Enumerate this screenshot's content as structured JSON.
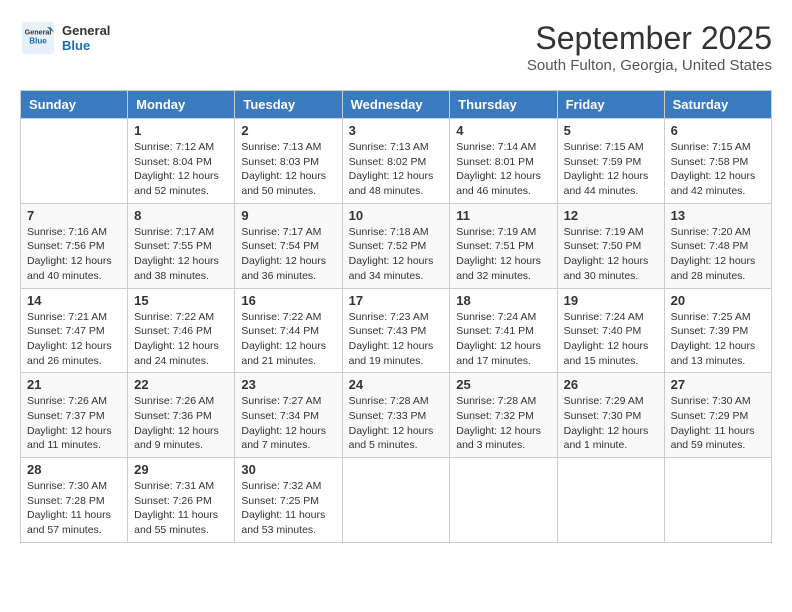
{
  "header": {
    "logo_general": "General",
    "logo_blue": "Blue",
    "month_title": "September 2025",
    "location": "South Fulton, Georgia, United States"
  },
  "days_of_week": [
    "Sunday",
    "Monday",
    "Tuesday",
    "Wednesday",
    "Thursday",
    "Friday",
    "Saturday"
  ],
  "weeks": [
    [
      {
        "day": "",
        "info": ""
      },
      {
        "day": "1",
        "info": "Sunrise: 7:12 AM\nSunset: 8:04 PM\nDaylight: 12 hours\nand 52 minutes."
      },
      {
        "day": "2",
        "info": "Sunrise: 7:13 AM\nSunset: 8:03 PM\nDaylight: 12 hours\nand 50 minutes."
      },
      {
        "day": "3",
        "info": "Sunrise: 7:13 AM\nSunset: 8:02 PM\nDaylight: 12 hours\nand 48 minutes."
      },
      {
        "day": "4",
        "info": "Sunrise: 7:14 AM\nSunset: 8:01 PM\nDaylight: 12 hours\nand 46 minutes."
      },
      {
        "day": "5",
        "info": "Sunrise: 7:15 AM\nSunset: 7:59 PM\nDaylight: 12 hours\nand 44 minutes."
      },
      {
        "day": "6",
        "info": "Sunrise: 7:15 AM\nSunset: 7:58 PM\nDaylight: 12 hours\nand 42 minutes."
      }
    ],
    [
      {
        "day": "7",
        "info": "Sunrise: 7:16 AM\nSunset: 7:56 PM\nDaylight: 12 hours\nand 40 minutes."
      },
      {
        "day": "8",
        "info": "Sunrise: 7:17 AM\nSunset: 7:55 PM\nDaylight: 12 hours\nand 38 minutes."
      },
      {
        "day": "9",
        "info": "Sunrise: 7:17 AM\nSunset: 7:54 PM\nDaylight: 12 hours\nand 36 minutes."
      },
      {
        "day": "10",
        "info": "Sunrise: 7:18 AM\nSunset: 7:52 PM\nDaylight: 12 hours\nand 34 minutes."
      },
      {
        "day": "11",
        "info": "Sunrise: 7:19 AM\nSunset: 7:51 PM\nDaylight: 12 hours\nand 32 minutes."
      },
      {
        "day": "12",
        "info": "Sunrise: 7:19 AM\nSunset: 7:50 PM\nDaylight: 12 hours\nand 30 minutes."
      },
      {
        "day": "13",
        "info": "Sunrise: 7:20 AM\nSunset: 7:48 PM\nDaylight: 12 hours\nand 28 minutes."
      }
    ],
    [
      {
        "day": "14",
        "info": "Sunrise: 7:21 AM\nSunset: 7:47 PM\nDaylight: 12 hours\nand 26 minutes."
      },
      {
        "day": "15",
        "info": "Sunrise: 7:22 AM\nSunset: 7:46 PM\nDaylight: 12 hours\nand 24 minutes."
      },
      {
        "day": "16",
        "info": "Sunrise: 7:22 AM\nSunset: 7:44 PM\nDaylight: 12 hours\nand 21 minutes."
      },
      {
        "day": "17",
        "info": "Sunrise: 7:23 AM\nSunset: 7:43 PM\nDaylight: 12 hours\nand 19 minutes."
      },
      {
        "day": "18",
        "info": "Sunrise: 7:24 AM\nSunset: 7:41 PM\nDaylight: 12 hours\nand 17 minutes."
      },
      {
        "day": "19",
        "info": "Sunrise: 7:24 AM\nSunset: 7:40 PM\nDaylight: 12 hours\nand 15 minutes."
      },
      {
        "day": "20",
        "info": "Sunrise: 7:25 AM\nSunset: 7:39 PM\nDaylight: 12 hours\nand 13 minutes."
      }
    ],
    [
      {
        "day": "21",
        "info": "Sunrise: 7:26 AM\nSunset: 7:37 PM\nDaylight: 12 hours\nand 11 minutes."
      },
      {
        "day": "22",
        "info": "Sunrise: 7:26 AM\nSunset: 7:36 PM\nDaylight: 12 hours\nand 9 minutes."
      },
      {
        "day": "23",
        "info": "Sunrise: 7:27 AM\nSunset: 7:34 PM\nDaylight: 12 hours\nand 7 minutes."
      },
      {
        "day": "24",
        "info": "Sunrise: 7:28 AM\nSunset: 7:33 PM\nDaylight: 12 hours\nand 5 minutes."
      },
      {
        "day": "25",
        "info": "Sunrise: 7:28 AM\nSunset: 7:32 PM\nDaylight: 12 hours\nand 3 minutes."
      },
      {
        "day": "26",
        "info": "Sunrise: 7:29 AM\nSunset: 7:30 PM\nDaylight: 12 hours\nand 1 minute."
      },
      {
        "day": "27",
        "info": "Sunrise: 7:30 AM\nSunset: 7:29 PM\nDaylight: 11 hours\nand 59 minutes."
      }
    ],
    [
      {
        "day": "28",
        "info": "Sunrise: 7:30 AM\nSunset: 7:28 PM\nDaylight: 11 hours\nand 57 minutes."
      },
      {
        "day": "29",
        "info": "Sunrise: 7:31 AM\nSunset: 7:26 PM\nDaylight: 11 hours\nand 55 minutes."
      },
      {
        "day": "30",
        "info": "Sunrise: 7:32 AM\nSunset: 7:25 PM\nDaylight: 11 hours\nand 53 minutes."
      },
      {
        "day": "",
        "info": ""
      },
      {
        "day": "",
        "info": ""
      },
      {
        "day": "",
        "info": ""
      },
      {
        "day": "",
        "info": ""
      }
    ]
  ]
}
